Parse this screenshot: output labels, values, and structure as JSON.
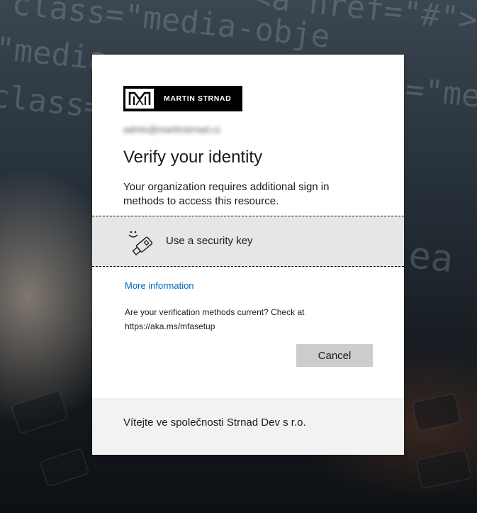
{
  "background": {
    "code_lines": [
      "class=\"media-obje",
      "<a href=\"#\">",
      "=\"media",
      "class=\"medi",
      "=\"me",
      "ea"
    ]
  },
  "brand": {
    "logo_text": "MARTIN STRNAD",
    "logo_icon": "m-monogram-icon"
  },
  "signin": {
    "account_email": "admin@martinstrnad.cz",
    "title": "Verify your identity",
    "description": "Your organization requires additional sign in methods to access this resource.",
    "option": {
      "icon": "security-key-icon",
      "label": "Use a security key"
    },
    "more_info_link": "More information",
    "verification_check": "Are your verification methods current? Check at https://aka.ms/mfasetup",
    "cancel_button": "Cancel"
  },
  "footer": {
    "welcome_text": "Vítejte ve společnosti Strnad Dev s r.o."
  },
  "colors": {
    "link": "#0067b8",
    "option_bg": "#e6e6e6",
    "button_bg": "#cccccc",
    "footer_bg": "#f2f2f2"
  }
}
